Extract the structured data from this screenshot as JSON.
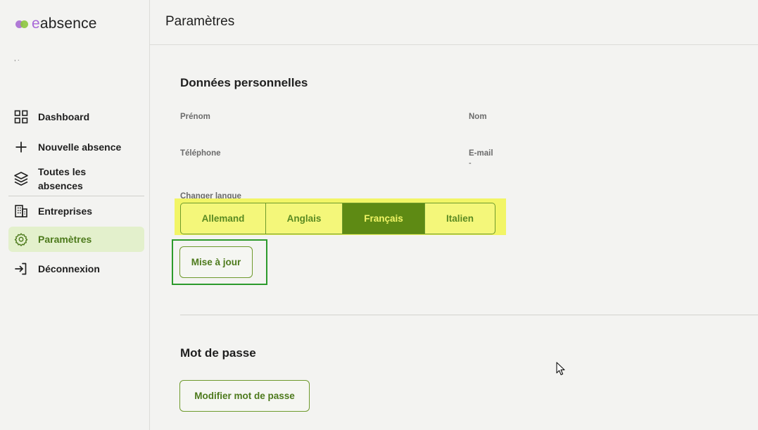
{
  "app": {
    "brand_prefix": "e",
    "brand_suffix": "absence",
    "user_line": ", ."
  },
  "sidebar": {
    "items": [
      {
        "label": "Dashboard",
        "icon": "grid-icon"
      },
      {
        "label": "Nouvelle absence",
        "icon": "plus-icon"
      },
      {
        "label": "Toutes les absences",
        "icon": "layers-icon"
      },
      {
        "label": "Entreprises",
        "icon": "building-icon"
      },
      {
        "label": "Paramètres",
        "icon": "gear-icon",
        "active": true
      },
      {
        "label": "Déconnexion",
        "icon": "logout-icon"
      }
    ]
  },
  "header": {
    "title": "Paramètres"
  },
  "personal": {
    "title": "Données personnelles",
    "first_name_label": "Prénom",
    "last_name_label": "Nom",
    "phone_label": "Téléphone",
    "email_label": "E-mail",
    "email_value": "-",
    "language_label": "Changer langue",
    "languages": [
      "Allemand",
      "Anglais",
      "Français",
      "Italien"
    ],
    "selected_language": "Français",
    "update_button": "Mise à jour"
  },
  "password": {
    "title": "Mot de passe",
    "change_button": "Modifier mot de passe"
  },
  "colors": {
    "accent": "#5e8a14",
    "highlight": "#f2f566",
    "active_nav_bg": "#e3f0cc"
  }
}
